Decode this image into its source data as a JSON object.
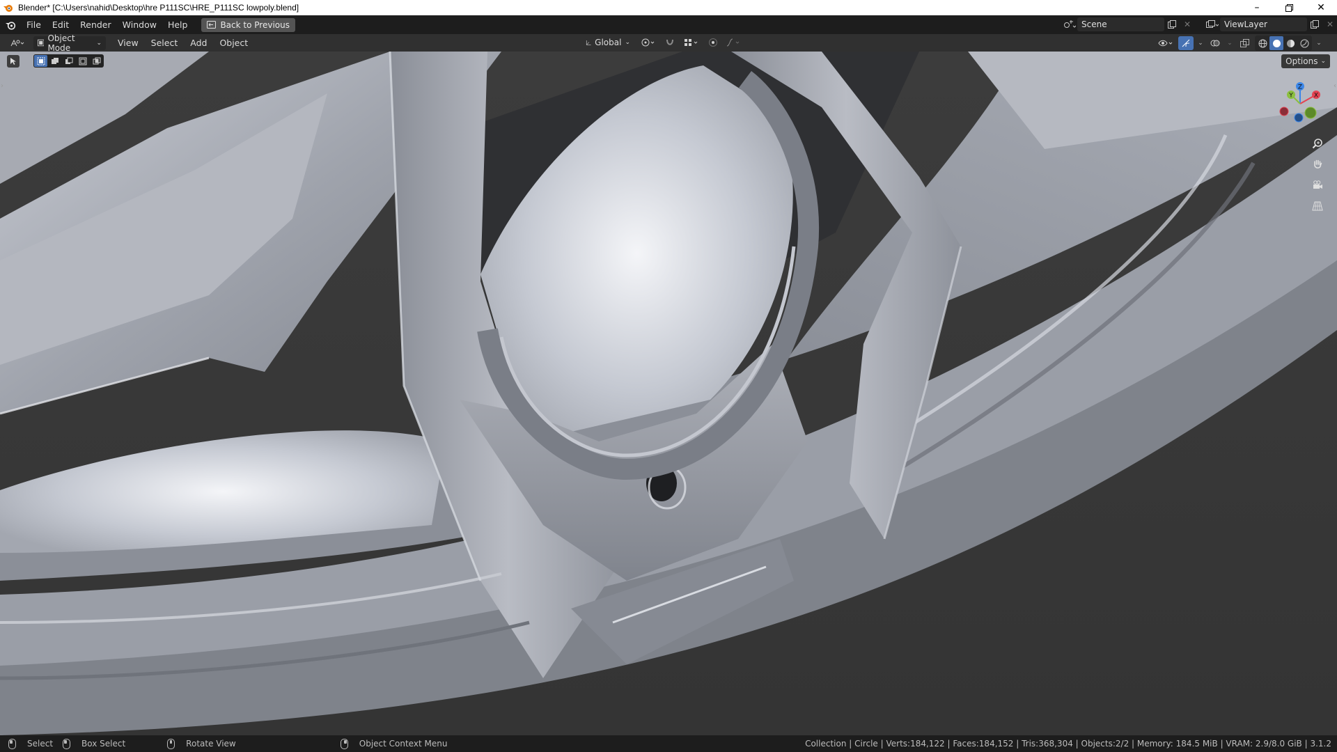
{
  "window": {
    "title": "Blender* [C:\\Users\\nahid\\Desktop\\hre P111SC\\HRE_P111SC lowpoly.blend]",
    "minimize_icon": "minimize-icon",
    "maximize_icon": "restore-icon",
    "close_icon": "close-icon"
  },
  "topbar": {
    "menus": [
      "File",
      "Edit",
      "Render",
      "Window",
      "Help"
    ],
    "back_button": "Back to Previous",
    "scene": "Scene",
    "view_layer": "ViewLayer"
  },
  "viewport_header": {
    "mode": "Object Mode",
    "menus": [
      "View",
      "Select",
      "Add",
      "Object"
    ],
    "transform_orientation": "Global"
  },
  "viewport": {
    "options_label": "Options",
    "gizmo_axes": [
      "X",
      "Y",
      "Z"
    ],
    "axis_colors": {
      "x": "#e44252",
      "y": "#8bbf3f",
      "z": "#3b86e8"
    }
  },
  "statusbar": {
    "select": "Select",
    "box_select": "Box Select",
    "rotate_view": "Rotate View",
    "context_menu": "Object Context Menu",
    "stats": "Collection | Circle | Verts:184,122 | Faces:184,152 | Tris:368,304 | Objects:2/2 | Memory: 184.5 MiB | VRAM: 2.9/8.0 GiB | 3.1.2"
  }
}
